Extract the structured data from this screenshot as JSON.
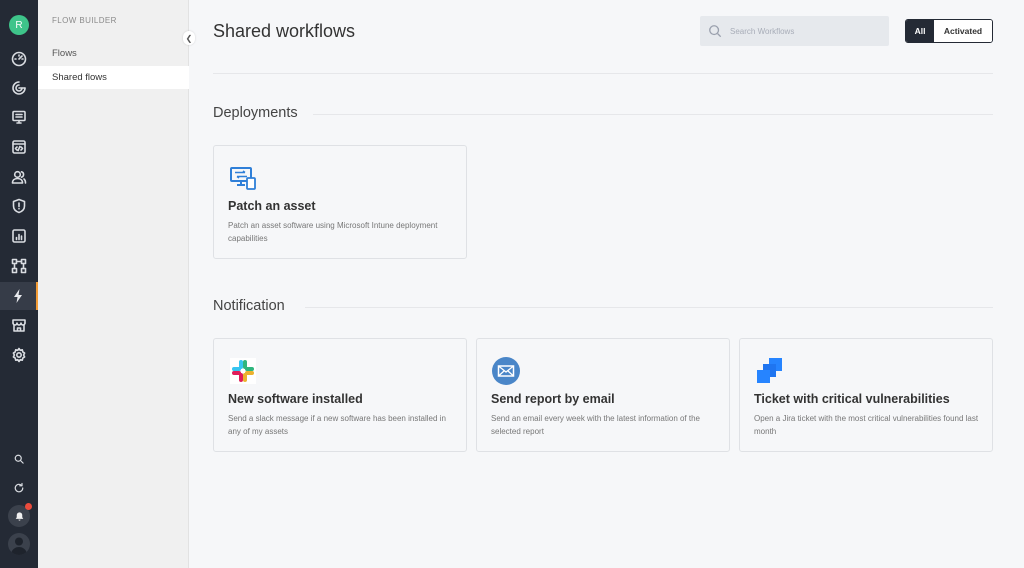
{
  "rail": {
    "avatar_initial": "R",
    "items": [
      {
        "icon": "dashboard-icon"
      },
      {
        "icon": "radar-icon"
      },
      {
        "icon": "monitor-list-icon"
      },
      {
        "icon": "code-window-icon"
      },
      {
        "icon": "users-icon"
      },
      {
        "icon": "shield-icon"
      },
      {
        "icon": "report-chart-icon"
      },
      {
        "icon": "integrations-icon"
      },
      {
        "icon": "lightning-icon",
        "active": true
      },
      {
        "icon": "store-icon"
      },
      {
        "icon": "gear-icon"
      }
    ],
    "bottom": [
      {
        "icon": "search-icon"
      },
      {
        "icon": "refresh-icon"
      },
      {
        "icon": "bell-icon",
        "has_badge": true
      },
      {
        "icon": "user-avatar-icon"
      }
    ],
    "accent_color": "#f39c35"
  },
  "sidebar": {
    "section_label": "FLOW BUILDER",
    "items": [
      {
        "label": "Flows",
        "active": false
      },
      {
        "label": "Shared flows",
        "active": true
      }
    ]
  },
  "header": {
    "title": "Shared workflows",
    "search_placeholder": "Search Workflows",
    "search_value": "",
    "filter": {
      "options": [
        "All",
        "Activated"
      ],
      "selected": "All"
    }
  },
  "sections": [
    {
      "title": "Deployments",
      "cards": [
        {
          "icon": "microsoft-intune-icon",
          "title": "Patch an asset",
          "description": "Patch an asset software using Microsoft Intune deployment capabilities"
        }
      ]
    },
    {
      "title": "Notification",
      "cards": [
        {
          "icon": "slack-icon",
          "title": "New software installed",
          "description": "Send a slack message if a new software has been installed in any of my assets"
        },
        {
          "icon": "email-icon",
          "title": "Send report by email",
          "description": "Send an email every week with the latest information of the selected report"
        },
        {
          "icon": "jira-icon",
          "title": "Ticket with critical vulnerabilities",
          "description": "Open a Jira ticket with the most critical vulnerabilities found last month"
        }
      ]
    }
  ]
}
